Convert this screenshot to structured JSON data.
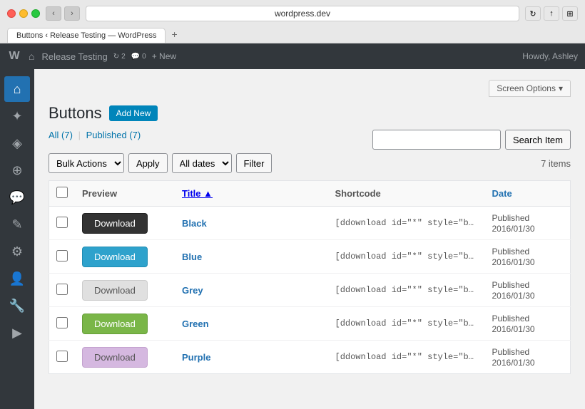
{
  "browser": {
    "url": "wordpress.dev",
    "tab_title": "Buttons ‹ Release Testing — WordPress",
    "new_tab_label": "+"
  },
  "admin_bar": {
    "site_name": "Release Testing",
    "updates_count": "2",
    "comments_count": "0",
    "new_label": "+ New",
    "user_greeting": "Howdy, Ashley"
  },
  "screen_options": {
    "label": "Screen Options",
    "arrow": "▾"
  },
  "page": {
    "title": "Buttons",
    "add_new_label": "Add New"
  },
  "filter": {
    "all_label": "All (7)",
    "published_label": "Published (7)",
    "separator": "|",
    "bulk_actions_placeholder": "Bulk Actions",
    "apply_label": "Apply",
    "dates_placeholder": "All dates",
    "filter_label": "Filter",
    "items_count": "7 items"
  },
  "search": {
    "placeholder": "",
    "button_label": "Search Item"
  },
  "table": {
    "headers": {
      "preview": "Preview",
      "title": "Title",
      "shortcode": "Shortcode",
      "date": "Date"
    },
    "rows": [
      {
        "id": 1,
        "button_label": "Download",
        "button_style": "black",
        "title": "Black",
        "shortcode": "[ddownload id=\"*\" style=\"butt",
        "status": "Published",
        "date": "2016/01/30"
      },
      {
        "id": 2,
        "button_label": "Download",
        "button_style": "blue",
        "title": "Blue",
        "shortcode": "[ddownload id=\"*\" style=\"butt",
        "status": "Published",
        "date": "2016/01/30"
      },
      {
        "id": 3,
        "button_label": "Download",
        "button_style": "grey",
        "title": "Grey",
        "shortcode": "[ddownload id=\"*\" style=\"butt",
        "status": "Published",
        "date": "2016/01/30"
      },
      {
        "id": 4,
        "button_label": "Download",
        "button_style": "green",
        "title": "Green",
        "shortcode": "[ddownload id=\"*\" style=\"butt",
        "status": "Published",
        "date": "2016/01/30"
      },
      {
        "id": 5,
        "button_label": "Download",
        "button_style": "purple",
        "title": "Purple",
        "shortcode": "[ddownload id=\"*\" style=\"butt",
        "status": "Published",
        "date": "2016/01/30"
      }
    ]
  },
  "sidebar": {
    "icons": [
      "⌂",
      "✦",
      "✒",
      "◈",
      "⊕",
      "✎",
      "⚙",
      "👤",
      "🔧",
      "▶"
    ]
  }
}
